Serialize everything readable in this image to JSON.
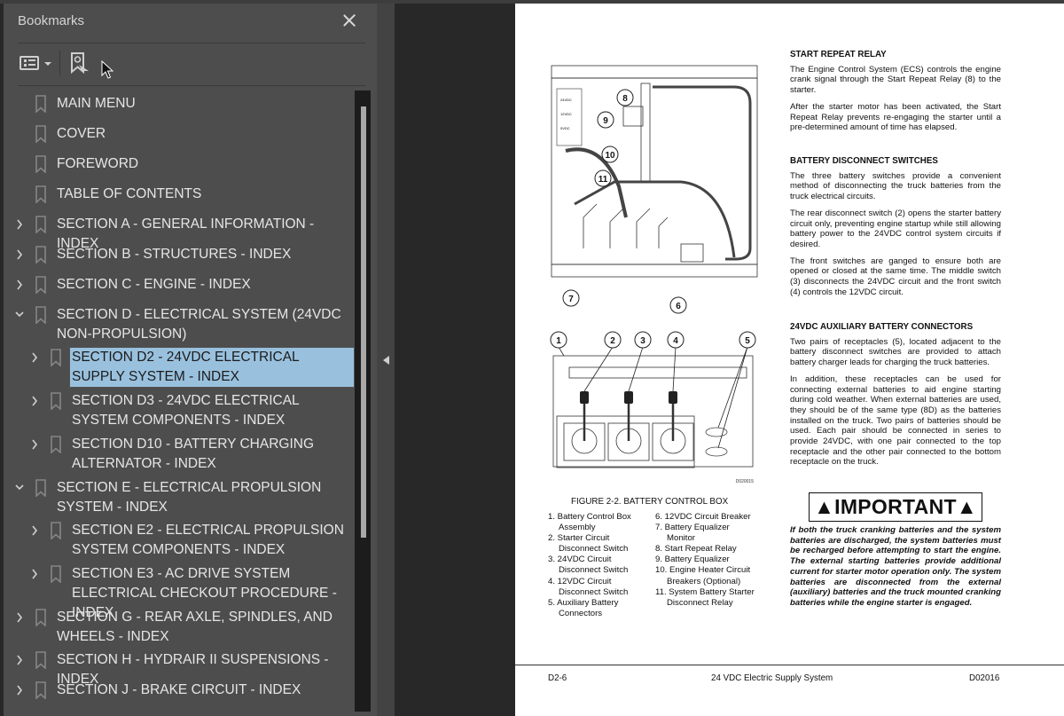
{
  "panel": {
    "title": "Bookmarks",
    "close_icon": "close-icon",
    "options_icon": "bookmark-options-icon",
    "find_icon": "find-current-bookmark-icon"
  },
  "bookmarks": [
    {
      "label": "MAIN MENU",
      "level": 0,
      "expander": "none"
    },
    {
      "label": "COVER",
      "level": 0,
      "expander": "none"
    },
    {
      "label": "FOREWORD",
      "level": 0,
      "expander": "none"
    },
    {
      "label": "TABLE OF CONTENTS",
      "level": 0,
      "expander": "none"
    },
    {
      "label": "SECTION A - GENERAL INFORMATION - INDEX",
      "level": 0,
      "expander": "collapsed"
    },
    {
      "label": "SECTION B - STRUCTURES - INDEX",
      "level": 0,
      "expander": "collapsed"
    },
    {
      "label": "SECTION C - ENGINE - INDEX",
      "level": 0,
      "expander": "collapsed"
    },
    {
      "label": "SECTION D - ELECTRICAL SYSTEM (24VDC NON-PROPULSION)",
      "level": 0,
      "expander": "expanded"
    },
    {
      "label": "SECTION D2 - 24VDC ELECTRICAL SUPPLY SYSTEM - INDEX",
      "level": 1,
      "expander": "collapsed",
      "selected": true
    },
    {
      "label": "SECTION D3 - 24VDC ELECTRICAL SYSTEM COMPONENTS - INDEX",
      "level": 1,
      "expander": "collapsed"
    },
    {
      "label": "SECTION D10 - BATTERY CHARGING ALTERNATOR - INDEX",
      "level": 1,
      "expander": "collapsed"
    },
    {
      "label": "SECTION E - ELECTRICAL PROPULSION SYSTEM - INDEX",
      "level": 0,
      "expander": "expanded"
    },
    {
      "label": "SECTION E2 - ELECTRICAL PROPULSION SYSTEM COMPONENTS - INDEX",
      "level": 1,
      "expander": "collapsed"
    },
    {
      "label": "SECTION E3 - AC DRIVE SYSTEM ELECTRICAL CHECKOUT PROCEDURE - INDEX",
      "level": 1,
      "expander": "collapsed"
    },
    {
      "label": "SECTION G - REAR AXLE, SPINDLES, AND WHEELS - INDEX",
      "level": 0,
      "expander": "collapsed"
    },
    {
      "label": "SECTION H - HYDRAIR II SUSPENSIONS - INDEX",
      "level": 0,
      "expander": "collapsed"
    },
    {
      "label": "SECTION J - BRAKE CIRCUIT - INDEX",
      "level": 0,
      "expander": "collapsed"
    }
  ],
  "document": {
    "sections": [
      {
        "heading": "START REPEAT RELAY",
        "paragraphs": [
          "The Engine Control System (ECS) controls the engine crank signal through the Start Repeat Relay (8) to the starter.",
          "After the starter motor has been activated, the Start Repeat Relay prevents re-engaging the starter until a pre-determined amount of time has elapsed."
        ]
      },
      {
        "heading": "BATTERY DISCONNECT SWITCHES",
        "paragraphs": [
          "The three battery switches provide a convenient method of disconnecting the truck batteries from the truck electrical circuits.",
          "The rear disconnect switch (2) opens the starter battery circuit only, preventing engine startup while still allowing battery power to the 24VDC control system circuits if desired.",
          "The front switches are ganged to ensure both are opened or closed at the same time. The middle switch (3) disconnects the 24VDC circuit and the front switch (4) controls the 12VDC circuit."
        ]
      },
      {
        "heading": "24VDC AUXILIARY BATTERY CONNECTORS",
        "paragraphs": [
          "Two pairs of receptacles (5), located adjacent to the battery disconnect switches are provided to attach battery charger leads for charging the truck batteries.",
          "In addition, these receptacles can be used for connecting external batteries to aid engine starting during cold weather. When external batteries are used, they should be of the same type (8D) as the batteries installed on the truck. Two pairs of batteries should be used. Each pair should be connected in series to provide 24VDC, with one pair connected to the top receptacle and the other pair connected to the bottom receptacle on the truck."
        ]
      }
    ],
    "important_label": "IMPORTANT",
    "important_text": "If both the truck cranking batteries and the system batteries are discharged, the system batteries must be recharged before attempting to start the engine. The external starting batteries provide additional current for starter motor operation only. The system batteries are disconnected from the external (auxiliary) batteries and the truck mounted cranking batteries while the engine starter is engaged.",
    "figure_caption": "FIGURE 2-2. BATTERY CONTROL BOX",
    "figure_id": "D020015",
    "panel_labels": {
      "v24": "24VDC",
      "v12": "12VDC",
      "v0": "0VDC"
    },
    "legend_left": [
      "1. Battery Control Box Assembly",
      "2. Starter Circuit Disconnect Switch",
      "3. 24VDC Circuit Disconnect Switch",
      "4. 12VDC Circuit Disconnect Switch",
      "5. Auxiliary Battery Connectors"
    ],
    "legend_right": [
      "6. 12VDC Circuit Breaker",
      "7. Battery Equalizer Monitor",
      "8. Start Repeat Relay",
      "9. Battery Equalizer",
      "10. Engine Heater Circuit Breakers (Optional)",
      "11. System Battery Starter Disconnect Relay"
    ],
    "callouts_top": [
      "8",
      "9",
      "10",
      "11",
      "7",
      "6"
    ],
    "callouts_bottom": [
      "1",
      "2",
      "3",
      "4",
      "5"
    ],
    "footer": {
      "page_number": "D2-6",
      "title": "24 VDC Electric Supply System",
      "doc_code": "D02016"
    }
  },
  "colors": {
    "panel_bg": "#4d4d4d",
    "selection": "#99c1de",
    "viewer_bg": "#282828"
  }
}
